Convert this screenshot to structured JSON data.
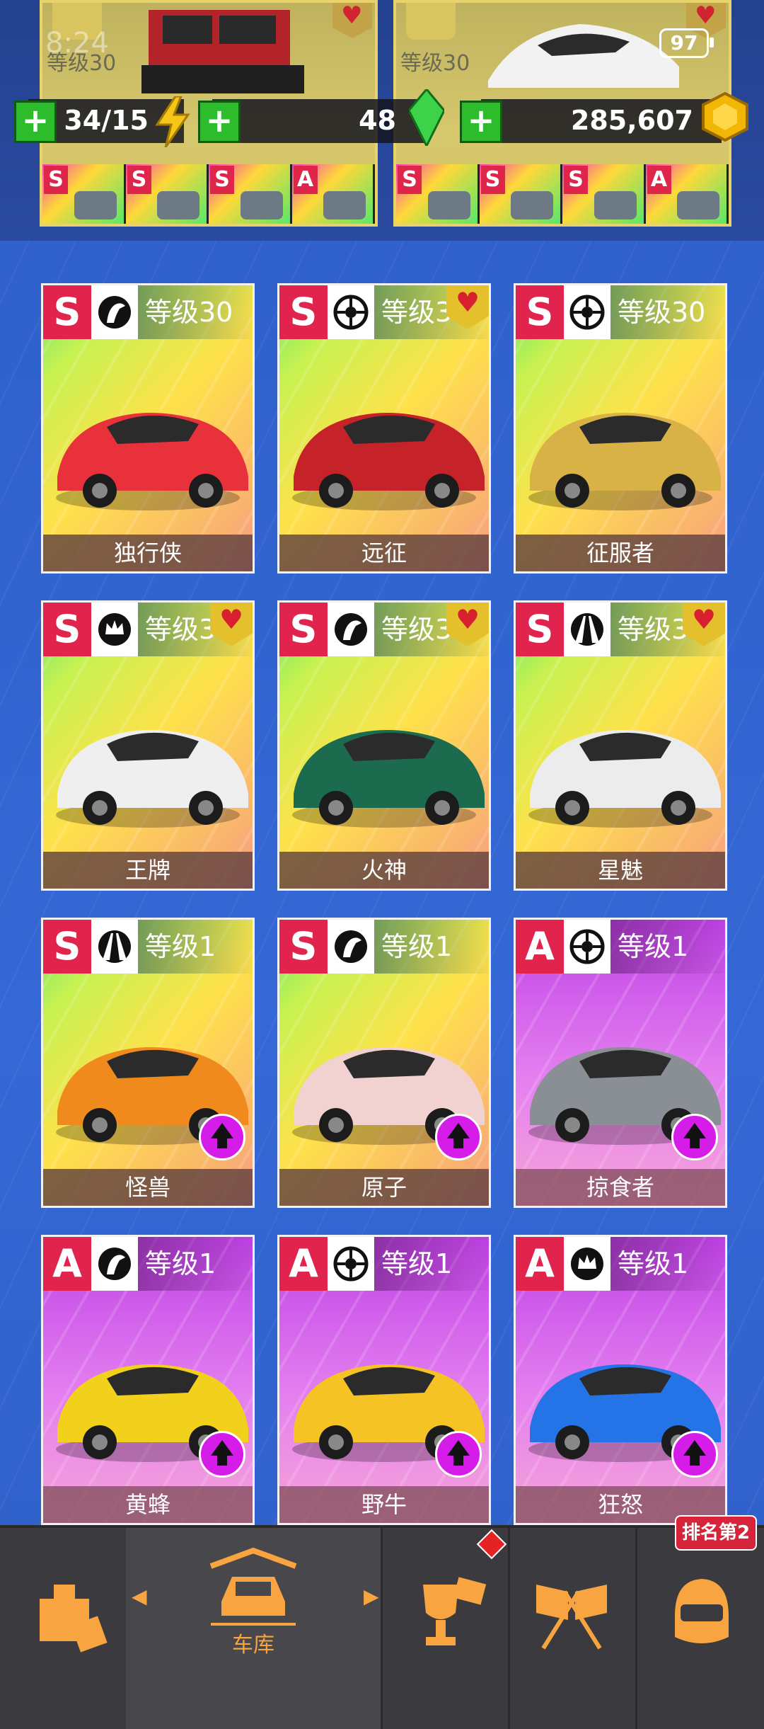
{
  "status": {
    "time": "8:24",
    "battery": "97"
  },
  "top_cards": [
    {
      "level": "等级30",
      "mods": [
        "S",
        "S",
        "S",
        "A"
      ],
      "mod_sub": "1"
    },
    {
      "level": "等级30",
      "mods": [
        "S",
        "S",
        "S",
        "A"
      ],
      "mod_sub": "1"
    }
  ],
  "hud": {
    "energy": "34/15",
    "gems": "48",
    "coins": "285,607"
  },
  "cars": [
    {
      "name": "独行侠",
      "rank": "S",
      "level": "等级30",
      "emblem": "horse-icon",
      "theme": "yellow",
      "favorite": false,
      "upgrade": false,
      "body_color": "#e8313a"
    },
    {
      "name": "远征",
      "rank": "S",
      "level": "等级3",
      "emblem": "wheel-icon",
      "theme": "yellow",
      "favorite": true,
      "upgrade": false,
      "body_color": "#c5222a"
    },
    {
      "name": "征服者",
      "rank": "S",
      "level": "等级30",
      "emblem": "wheel-icon",
      "theme": "yellow",
      "favorite": false,
      "upgrade": false,
      "body_color": "#d8b246"
    },
    {
      "name": "王牌",
      "rank": "S",
      "level": "等级3",
      "emblem": "crown-icon",
      "theme": "yellow",
      "favorite": true,
      "upgrade": false,
      "body_color": "#efefef"
    },
    {
      "name": "火神",
      "rank": "S",
      "level": "等级3",
      "emblem": "horse-icon",
      "theme": "yellow",
      "favorite": true,
      "upgrade": false,
      "body_color": "#1d6b4f"
    },
    {
      "name": "星魅",
      "rank": "S",
      "level": "等级3",
      "emblem": "road-icon",
      "theme": "yellow",
      "favorite": true,
      "upgrade": false,
      "body_color": "#ececec"
    },
    {
      "name": "怪兽",
      "rank": "S",
      "level": "等级1",
      "emblem": "road-icon",
      "theme": "yellow",
      "favorite": false,
      "upgrade": true,
      "body_color": "#f08a1c"
    },
    {
      "name": "原子",
      "rank": "S",
      "level": "等级1",
      "emblem": "horse-icon",
      "theme": "yellow",
      "favorite": false,
      "upgrade": true,
      "body_color": "#f1d2d0"
    },
    {
      "name": "掠食者",
      "rank": "A",
      "level": "等级1",
      "emblem": "wheel-icon",
      "theme": "pink",
      "favorite": false,
      "upgrade": true,
      "body_color": "#8a8f95"
    },
    {
      "name": "黄蜂",
      "rank": "A",
      "level": "等级1",
      "emblem": "horse-icon",
      "theme": "pink",
      "favorite": false,
      "upgrade": true,
      "body_color": "#f2d11c"
    },
    {
      "name": "野牛",
      "rank": "A",
      "level": "等级1",
      "emblem": "wheel-icon",
      "theme": "pink",
      "favorite": false,
      "upgrade": true,
      "body_color": "#f5c323"
    },
    {
      "name": "狂怒",
      "rank": "A",
      "level": "等级1",
      "emblem": "crown-icon",
      "theme": "pink",
      "favorite": false,
      "upgrade": true,
      "body_color": "#2474e8"
    }
  ],
  "nav": {
    "garage_label": "车库",
    "rank_badge": "排名第2",
    "items": [
      "shop-icon",
      "garage-icon",
      "trophy-icon",
      "race-flags-icon",
      "helmet-icon"
    ]
  }
}
